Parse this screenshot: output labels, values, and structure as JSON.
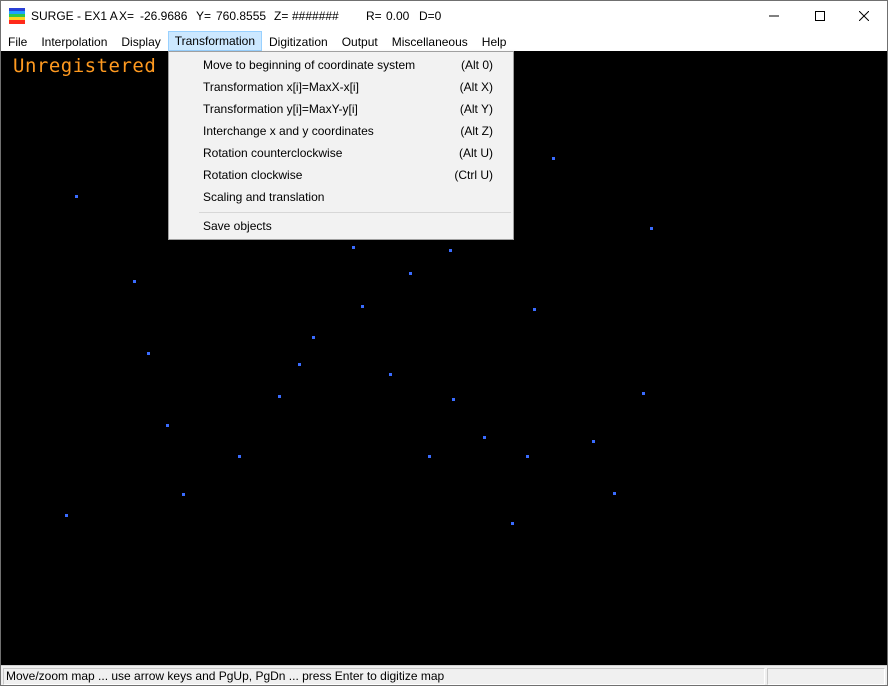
{
  "window": {
    "title": "SURGE - EX1 A",
    "coords": {
      "x_label": "X=",
      "x_value": "-26.9686",
      "y_label": "Y=",
      "y_value": "760.8555",
      "z_label": "Z=",
      "z_value": "#######",
      "r_label": "R=",
      "r_value": "0.00",
      "d_text": "D=0"
    }
  },
  "menu": {
    "items": [
      {
        "label": "File"
      },
      {
        "label": "Interpolation"
      },
      {
        "label": "Display"
      },
      {
        "label": "Transformation"
      },
      {
        "label": "Digitization"
      },
      {
        "label": "Output"
      },
      {
        "label": "Miscellaneous"
      },
      {
        "label": "Help"
      }
    ],
    "active": "Transformation"
  },
  "transformation_menu": {
    "items": [
      {
        "label": "Move to beginning of coordinate system",
        "shortcut": "(Alt 0)"
      },
      {
        "label": "Transformation x[i]=MaxX-x[i]",
        "shortcut": "(Alt X)"
      },
      {
        "label": "Transformation y[i]=MaxY-y[i]",
        "shortcut": "(Alt Y)"
      },
      {
        "label": "Interchange x and y coordinates",
        "shortcut": "(Alt Z)"
      },
      {
        "label": "Rotation counterclockwise",
        "shortcut": "(Alt U)"
      },
      {
        "label": "Rotation clockwise",
        "shortcut": "(Ctrl U)"
      },
      {
        "label": "Scaling and translation",
        "shortcut": ""
      },
      {
        "label": "Save objects",
        "shortcut": ""
      }
    ]
  },
  "canvas": {
    "watermark": "Unregistered",
    "background_color": "#000000",
    "point_color": "#3a6cff",
    "watermark_color": "#ff9a20"
  },
  "status": {
    "text": "Move/zoom map ... use arrow keys and PgUp, PgDn ... press Enter to digitize map"
  }
}
